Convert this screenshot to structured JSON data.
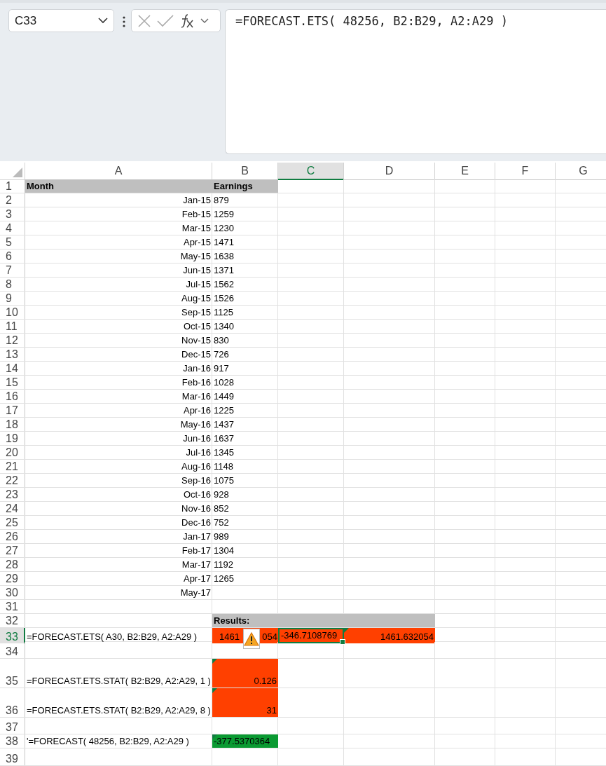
{
  "name_box": {
    "value": "C33"
  },
  "formula_bar": {
    "value": "=FORECAST.ETS( 48256, B2:B29, A2:A29 )"
  },
  "columns": [
    {
      "label": "A",
      "selected": false
    },
    {
      "label": "B",
      "selected": false
    },
    {
      "label": "C",
      "selected": true
    },
    {
      "label": "D",
      "selected": false
    },
    {
      "label": "E",
      "selected": false
    },
    {
      "label": "F",
      "selected": false
    },
    {
      "label": "G",
      "selected": false
    }
  ],
  "rows": [
    {
      "number": "1",
      "selected": false,
      "cells": [
        {
          "text": "Month",
          "right_aligned": false,
          "bold": true,
          "color": "#bfbfbf"
        },
        {
          "text": "Earnings",
          "right_aligned": false,
          "bold": true,
          "color": "#bfbfbf"
        }
      ]
    },
    {
      "number": "2",
      "selected": false,
      "cells": [
        {
          "text": "Jan-15",
          "right_aligned": true
        },
        {
          "text": "879",
          "right_aligned": false
        }
      ]
    },
    {
      "number": "3",
      "selected": false,
      "cells": [
        {
          "text": "Feb-15",
          "right_aligned": true
        },
        {
          "text": "1259",
          "right_aligned": false
        }
      ]
    },
    {
      "number": "4",
      "selected": false,
      "cells": [
        {
          "text": "Mar-15",
          "right_aligned": true
        },
        {
          "text": "1230",
          "right_aligned": false
        }
      ]
    },
    {
      "number": "5",
      "selected": false,
      "cells": [
        {
          "text": "Apr-15",
          "right_aligned": true
        },
        {
          "text": "1471",
          "right_aligned": false
        }
      ]
    },
    {
      "number": "6",
      "selected": false,
      "cells": [
        {
          "text": "May-15",
          "right_aligned": true
        },
        {
          "text": "1638",
          "right_aligned": false
        }
      ]
    },
    {
      "number": "7",
      "selected": false,
      "cells": [
        {
          "text": "Jun-15",
          "right_aligned": true
        },
        {
          "text": "1371",
          "right_aligned": false
        }
      ]
    },
    {
      "number": "8",
      "selected": false,
      "cells": [
        {
          "text": "Jul-15",
          "right_aligned": true
        },
        {
          "text": "1562",
          "right_aligned": false
        }
      ]
    },
    {
      "number": "9",
      "selected": false,
      "cells": [
        {
          "text": "Aug-15",
          "right_aligned": true
        },
        {
          "text": "1526",
          "right_aligned": false
        }
      ]
    },
    {
      "number": "10",
      "selected": false,
      "cells": [
        {
          "text": "Sep-15",
          "right_aligned": true
        },
        {
          "text": "1125",
          "right_aligned": false
        }
      ]
    },
    {
      "number": "11",
      "selected": false,
      "cells": [
        {
          "text": "Oct-15",
          "right_aligned": true
        },
        {
          "text": "1340",
          "right_aligned": false
        }
      ]
    },
    {
      "number": "12",
      "selected": false,
      "cells": [
        {
          "text": "Nov-15",
          "right_aligned": true
        },
        {
          "text": "830",
          "right_aligned": false
        }
      ]
    },
    {
      "number": "13",
      "selected": false,
      "cells": [
        {
          "text": "Dec-15",
          "right_aligned": true
        },
        {
          "text": "726",
          "right_aligned": false
        }
      ]
    },
    {
      "number": "14",
      "selected": false,
      "cells": [
        {
          "text": "Jan-16",
          "right_aligned": true
        },
        {
          "text": "917",
          "right_aligned": false
        }
      ]
    },
    {
      "number": "15",
      "selected": false,
      "cells": [
        {
          "text": "Feb-16",
          "right_aligned": true
        },
        {
          "text": "1028",
          "right_aligned": false
        }
      ]
    },
    {
      "number": "16",
      "selected": false,
      "cells": [
        {
          "text": "Mar-16",
          "right_aligned": true
        },
        {
          "text": "1449",
          "right_aligned": false
        }
      ]
    },
    {
      "number": "17",
      "selected": false,
      "cells": [
        {
          "text": "Apr-16",
          "right_aligned": true
        },
        {
          "text": "1225",
          "right_aligned": false
        }
      ]
    },
    {
      "number": "18",
      "selected": false,
      "cells": [
        {
          "text": "May-16",
          "right_aligned": true
        },
        {
          "text": "1437",
          "right_aligned": false
        }
      ]
    },
    {
      "number": "19",
      "selected": false,
      "cells": [
        {
          "text": "Jun-16",
          "right_aligned": true
        },
        {
          "text": "1637",
          "right_aligned": false
        }
      ]
    },
    {
      "number": "20",
      "selected": false,
      "cells": [
        {
          "text": "Jul-16",
          "right_aligned": true
        },
        {
          "text": "1345",
          "right_aligned": false
        }
      ]
    },
    {
      "number": "21",
      "selected": false,
      "cells": [
        {
          "text": "Aug-16",
          "right_aligned": true
        },
        {
          "text": "1148",
          "right_aligned": false
        }
      ]
    },
    {
      "number": "22",
      "selected": false,
      "cells": [
        {
          "text": "Sep-16",
          "right_aligned": true
        },
        {
          "text": "1075",
          "right_aligned": false
        }
      ]
    },
    {
      "number": "23",
      "selected": false,
      "cells": [
        {
          "text": "Oct-16",
          "right_aligned": true
        },
        {
          "text": "928",
          "right_aligned": false
        }
      ]
    },
    {
      "number": "24",
      "selected": false,
      "cells": [
        {
          "text": "Nov-16",
          "right_aligned": true
        },
        {
          "text": "852",
          "right_aligned": false
        }
      ]
    },
    {
      "number": "25",
      "selected": false,
      "cells": [
        {
          "text": "Dec-16",
          "right_aligned": true
        },
        {
          "text": "752",
          "right_aligned": false
        }
      ]
    },
    {
      "number": "26",
      "selected": false,
      "cells": [
        {
          "text": "Jan-17",
          "right_aligned": true
        },
        {
          "text": "989",
          "right_aligned": false
        }
      ]
    },
    {
      "number": "27",
      "selected": false,
      "cells": [
        {
          "text": "Feb-17",
          "right_aligned": true
        },
        {
          "text": "1304",
          "right_aligned": false
        }
      ]
    },
    {
      "number": "28",
      "selected": false,
      "cells": [
        {
          "text": "Mar-17",
          "right_aligned": true
        },
        {
          "text": "1192",
          "right_aligned": false
        }
      ]
    },
    {
      "number": "29",
      "selected": false,
      "cells": [
        {
          "text": "Apr-17",
          "right_aligned": true
        },
        {
          "text": "1265",
          "right_aligned": false
        }
      ]
    },
    {
      "number": "30",
      "selected": false,
      "cells": [
        {
          "text": "May-17",
          "right_aligned": true
        }
      ]
    },
    {
      "number": "31",
      "selected": false,
      "cells": []
    },
    {
      "number": "32",
      "selected": false,
      "cells": [
        {},
        {
          "text": "Results:",
          "right_aligned": false,
          "bold": true,
          "color": "#bfbfbf"
        },
        {
          "color": "#bfbfbf"
        },
        {
          "color": "#bfbfbf"
        }
      ]
    },
    {
      "number": "33",
      "selected": true,
      "cells": [
        {
          "text": "=FORECAST.ETS( A30, B2:B29, A2:A29 )",
          "right_aligned": false
        },
        {
          "text_parts": [
            "1461",
            "054"
          ],
          "color": "#ff4000",
          "warning": true
        },
        {
          "text": "-346.7108769",
          "right_aligned": false,
          "color": "#ff4000",
          "selected": true
        },
        {
          "text": "1461.632054",
          "right_aligned": true,
          "color": "#ff4000",
          "flagged": true
        }
      ]
    },
    {
      "number": "34",
      "selected": false,
      "cells": []
    },
    {
      "number": "35",
      "selected": false,
      "cells": [
        {
          "text": "=FORECAST.ETS.STAT( B2:B29, A2:A29, 1 )",
          "right_aligned": false
        },
        {
          "text": "0.126",
          "right_aligned": true,
          "color": "#ff4000",
          "flagged": true
        }
      ]
    },
    {
      "number": "36",
      "selected": false,
      "cells": [
        {
          "text": "=FORECAST.ETS.STAT( B2:B29, A2:A29, 8 )",
          "right_aligned": false
        },
        {
          "text": "31",
          "right_aligned": true,
          "color": "#ff4000",
          "flagged": true
        }
      ]
    },
    {
      "number": "37",
      "selected": false,
      "cells": []
    },
    {
      "number": "38",
      "selected": false,
      "cells": [
        {
          "text": "'=FORECAST( 48256, B2:B29, A2:A29 )",
          "right_aligned": false
        },
        {
          "text": "-377.5370364",
          "right_aligned": false,
          "color": "#0a9a32",
          "flagged": true
        }
      ]
    },
    {
      "number": "39",
      "selected": false,
      "cells": []
    }
  ]
}
